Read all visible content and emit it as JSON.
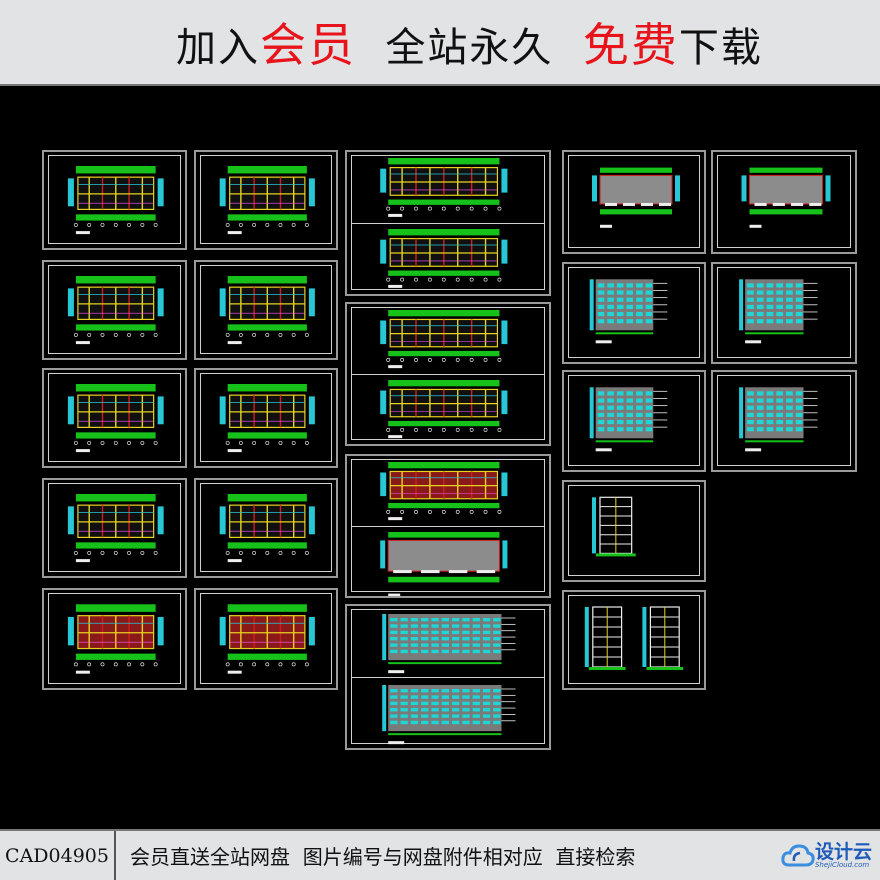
{
  "banner": {
    "segments": [
      {
        "text": "加入",
        "highlight": false
      },
      {
        "text": "会员",
        "highlight": true
      },
      {
        "text": "  全站永久  ",
        "highlight": false
      },
      {
        "text": "免费",
        "highlight": true
      },
      {
        "text": "下载",
        "highlight": false
      }
    ],
    "highlight_color": "#e8141c"
  },
  "drawings": {
    "background_color": "#000000",
    "sheets": [
      {
        "id": "plan-1",
        "type": "floor-plan"
      },
      {
        "id": "plan-2",
        "type": "floor-plan"
      },
      {
        "id": "plan-3",
        "type": "floor-plan"
      },
      {
        "id": "plan-4",
        "type": "floor-plan"
      },
      {
        "id": "plan-5",
        "type": "floor-plan"
      },
      {
        "id": "plan-6",
        "type": "floor-plan"
      },
      {
        "id": "plan-7",
        "type": "floor-plan"
      },
      {
        "id": "plan-8",
        "type": "floor-plan"
      },
      {
        "id": "plan-9",
        "type": "floor-plan"
      },
      {
        "id": "plan-10",
        "type": "floor-plan"
      },
      {
        "id": "plan-double-1",
        "type": "floor-plan-double"
      },
      {
        "id": "plan-double-2",
        "type": "floor-plan-double"
      },
      {
        "id": "plan-double-3",
        "type": "floor-plan-roof-double"
      },
      {
        "id": "elevation-double",
        "type": "elevation-double"
      },
      {
        "id": "roof-1",
        "type": "roof-plan"
      },
      {
        "id": "roof-2",
        "type": "roof-plan"
      },
      {
        "id": "elevation-1",
        "type": "elevation"
      },
      {
        "id": "elevation-2",
        "type": "elevation"
      },
      {
        "id": "elevation-3",
        "type": "elevation"
      },
      {
        "id": "elevation-4",
        "type": "elevation"
      },
      {
        "id": "section-1",
        "type": "section"
      },
      {
        "id": "section-2",
        "type": "section-double"
      }
    ]
  },
  "footer": {
    "code": "CAD04905",
    "slogan": "会员直送全站网盘  图片编号与网盘附件相对应  直接检索",
    "logo_name": "设计云",
    "logo_sub": "ShejiCloud.com"
  }
}
